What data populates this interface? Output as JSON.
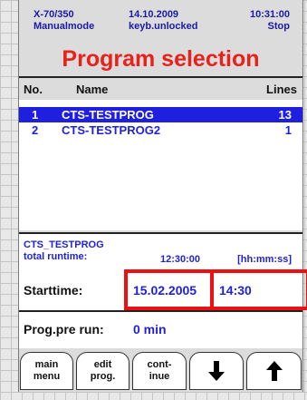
{
  "status": {
    "machine": "X-70/350",
    "mode": "Manualmode",
    "date": "14.10.2009",
    "keyboard": "keyb.unlocked",
    "time": "10:31:00",
    "state": "Stop"
  },
  "title": "Program selection",
  "table": {
    "headers": {
      "no": "No.",
      "name": "Name",
      "lines": "Lines"
    },
    "rows": [
      {
        "no": "1",
        "name": "CTS-TESTPROG",
        "lines": "13",
        "selected": true
      },
      {
        "no": "2",
        "name": "CTS-TESTPROG2",
        "lines": "1",
        "selected": false
      }
    ]
  },
  "info": {
    "program": "CTS_TESTPROG",
    "runtime_label": "total runtime:",
    "runtime_value": "12:30:00",
    "runtime_unit": "[hh:mm:ss]"
  },
  "start": {
    "label": "Starttime:",
    "date": "15.02.2005",
    "time": "14:30"
  },
  "prerun": {
    "label": "Prog.pre run:",
    "value": "0 min"
  },
  "buttons": {
    "main_line1": "main",
    "main_line2": "menu",
    "edit_line1": "edit",
    "edit_line2": "prog.",
    "cont_line1": "cont-",
    "cont_line2": "inue"
  },
  "colors": {
    "accent_blue": "#1f1fe0",
    "title_red": "#e8211b",
    "highlight_red": "#ee1010"
  }
}
